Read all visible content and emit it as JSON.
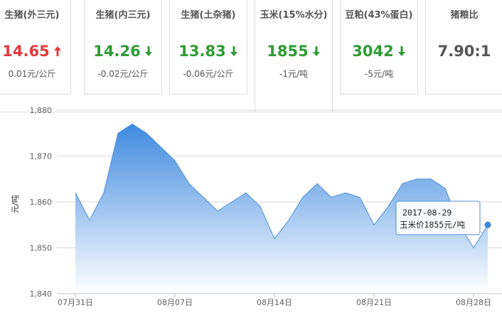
{
  "cards": [
    {
      "label": "生猪(外三元)",
      "price": "14.65",
      "change": "0.01元/公斤",
      "trend": "up"
    },
    {
      "label": "生猪(内三元)",
      "price": "14.26",
      "change": "-0.02元/公斤",
      "trend": "down"
    },
    {
      "label": "生猪(土杂猪)",
      "price": "13.83",
      "change": "-0.06元/公斤",
      "trend": "down"
    },
    {
      "label": "玉米(15%水分)",
      "price": "1855",
      "change": "-1元/吨",
      "trend": "down"
    },
    {
      "label": "豆粕(43%蛋白)",
      "price": "3042",
      "change": "-5元/吨",
      "trend": "down"
    },
    {
      "label": "猪粮比",
      "price": "7.90:1",
      "change": "",
      "trend": "none"
    }
  ],
  "active_card": 3,
  "colors": {
    "up": "#e4393c",
    "down": "#2e9b33",
    "series": "#4a8fd8",
    "area_top": "#3f8ae0",
    "area_bottom": "#ffffff",
    "marker": "#3a85d6"
  },
  "chart_data": {
    "type": "area",
    "ylabel": "元/吨",
    "ylim": [
      1840,
      1880
    ],
    "yticks": [
      "1,880",
      "1,870",
      "1,860",
      "1,850",
      "1,840"
    ],
    "ytick_values": [
      1880,
      1870,
      1860,
      1850,
      1840
    ],
    "x_tick_labels": [
      "07月31日",
      "08月07日",
      "08月14日",
      "08月21日",
      "08月28日"
    ],
    "x_tick_dates": [
      "2017-07-31",
      "2017-08-07",
      "2017-08-14",
      "2017-08-21",
      "2017-08-28"
    ],
    "x": [
      "2017-07-31",
      "2017-08-01",
      "2017-08-02",
      "2017-08-03",
      "2017-08-04",
      "2017-08-05",
      "2017-08-06",
      "2017-08-07",
      "2017-08-08",
      "2017-08-09",
      "2017-08-10",
      "2017-08-11",
      "2017-08-12",
      "2017-08-13",
      "2017-08-14",
      "2017-08-15",
      "2017-08-16",
      "2017-08-17",
      "2017-08-18",
      "2017-08-19",
      "2017-08-20",
      "2017-08-21",
      "2017-08-22",
      "2017-08-23",
      "2017-08-24",
      "2017-08-25",
      "2017-08-26",
      "2017-08-27",
      "2017-08-28",
      "2017-08-29"
    ],
    "values": [
      1862,
      1856,
      1862,
      1875,
      1877,
      1875,
      1872,
      1869,
      1864,
      1861,
      1858,
      1860,
      1862,
      1859,
      1852,
      1856,
      1861,
      1864,
      1861,
      1862,
      1861,
      1855,
      1859,
      1864,
      1865,
      1865,
      1863,
      1855,
      1850,
      1855
    ],
    "grid": true,
    "legend": "none",
    "tooltip": {
      "date": "2017-08-29",
      "text": "玉米价1855元/吨"
    }
  }
}
